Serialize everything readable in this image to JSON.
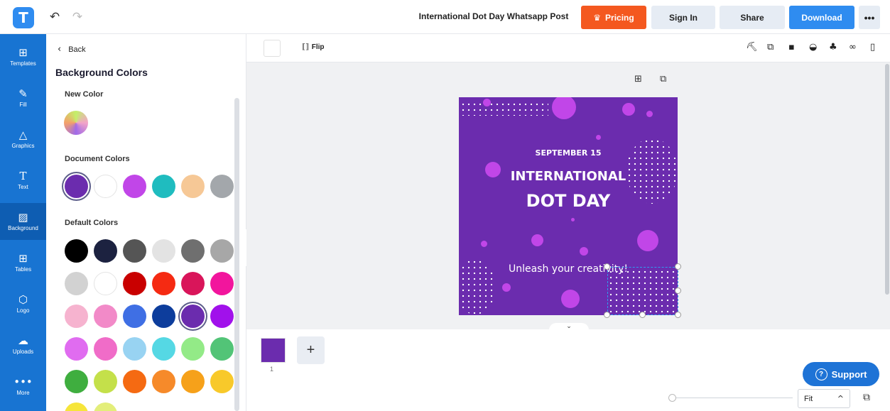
{
  "topbar": {
    "logo": "T",
    "document_title": "International Dot Day Whatsapp Post",
    "pricing_label": "Pricing",
    "signin_label": "Sign In",
    "share_label": "Share",
    "download_label": "Download",
    "more_label": "•••"
  },
  "rail": {
    "items": [
      {
        "label": "Templates",
        "icon": "templates-icon"
      },
      {
        "label": "Fill",
        "icon": "pencil-icon"
      },
      {
        "label": "Graphics",
        "icon": "shapes-icon"
      },
      {
        "label": "Text",
        "icon": "text-icon"
      },
      {
        "label": "Background",
        "icon": "background-icon"
      },
      {
        "label": "Tables",
        "icon": "table-icon"
      },
      {
        "label": "Logo",
        "icon": "logo-icon"
      },
      {
        "label": "Uploads",
        "icon": "upload-icon"
      },
      {
        "label": "More",
        "icon": "more-icon"
      }
    ]
  },
  "panel": {
    "back_label": "Back",
    "title": "Background Colors",
    "new_color_label": "New Color",
    "document_colors_label": "Document Colors",
    "default_colors_label": "Default Colors",
    "document_colors": [
      "#6b2cae",
      "#ffffff",
      "#c146e8",
      "#1fbcbf",
      "#f6c896",
      "#a3a7ab"
    ],
    "default_colors": [
      "#000000",
      "#1c2240",
      "#555555",
      "#e3e3e3",
      "#6f6f6f",
      "#a7a7a7",
      "#d2d2d2",
      "#ffffff",
      "#c90000",
      "#f52a12",
      "#d9155a",
      "#f2159d",
      "#f6b3cf",
      "#f28ac8",
      "#3f6fe4",
      "#0d3d9c",
      "#6b2cae",
      "#a111eb",
      "#e06cf0",
      "#f06cc8",
      "#98d3f2",
      "#55d8e4",
      "#93ea87",
      "#52c477",
      "#3fae3f",
      "#c4e04a",
      "#f56a12",
      "#f68a2a",
      "#f6a11a",
      "#f8c92a",
      "#f6e53a",
      "#e3ee7a"
    ]
  },
  "toolbar": {
    "flip_label": "Flip"
  },
  "design": {
    "date_text": "SEPTEMBER 15",
    "title_line1": "INTERNATIONAL",
    "title_line2": "DOT DAY",
    "tagline": "Unleash your creativity!"
  },
  "pages": {
    "current_page": "1",
    "add_label": "+"
  },
  "zoom": {
    "value": "Fit"
  },
  "support_label": "Support"
}
